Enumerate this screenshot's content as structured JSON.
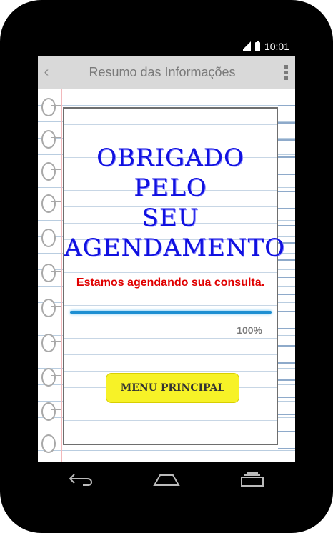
{
  "statusbar": {
    "time": "10:01"
  },
  "appbar": {
    "title": "Resumo das Informações",
    "back_icon": "chevron-left-icon",
    "menu_icon": "overflow-menu-icon"
  },
  "card": {
    "heading_line1": "OBRIGADO PELO",
    "heading_line2": "SEU",
    "heading_line3": "AGENDAMENTO",
    "message": "Estamos agendando sua consulta.",
    "progress_value": 1.0,
    "progress_label": "100%",
    "menu_button_label": "MENU PRINCIPAL"
  },
  "colors": {
    "heading": "#1010e0",
    "message": "#e00000",
    "button": "#f7f227",
    "progress": "#1e8fd2"
  },
  "navbar": {
    "back_icon": "back-arrow-icon",
    "home_icon": "home-icon",
    "recents_icon": "recents-icon"
  }
}
